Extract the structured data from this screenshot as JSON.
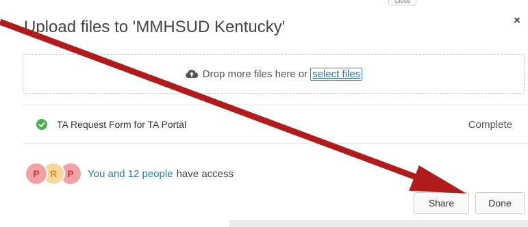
{
  "tooltip": {
    "label": "Close"
  },
  "dialog": {
    "title": "Upload files to 'MMHSUD Kentucky'",
    "close_symbol": "×"
  },
  "dropzone": {
    "icon": "cloud-upload-icon",
    "text": "Drop more files here or",
    "link_label": "select files"
  },
  "files": [
    {
      "icon": "check-circle-icon",
      "name": "TA Request Form for TA Portal",
      "status": "Complete"
    }
  ],
  "access": {
    "avatars": [
      "P",
      "R",
      "P"
    ],
    "link_text": "You and 12 people",
    "text": "have access"
  },
  "buttons": {
    "share": "Share",
    "done": "Done"
  },
  "colors": {
    "arrow": "#b01c1c",
    "check": "#4caf50",
    "link": "#2a6fb0",
    "access_link": "#2a7f8f"
  }
}
